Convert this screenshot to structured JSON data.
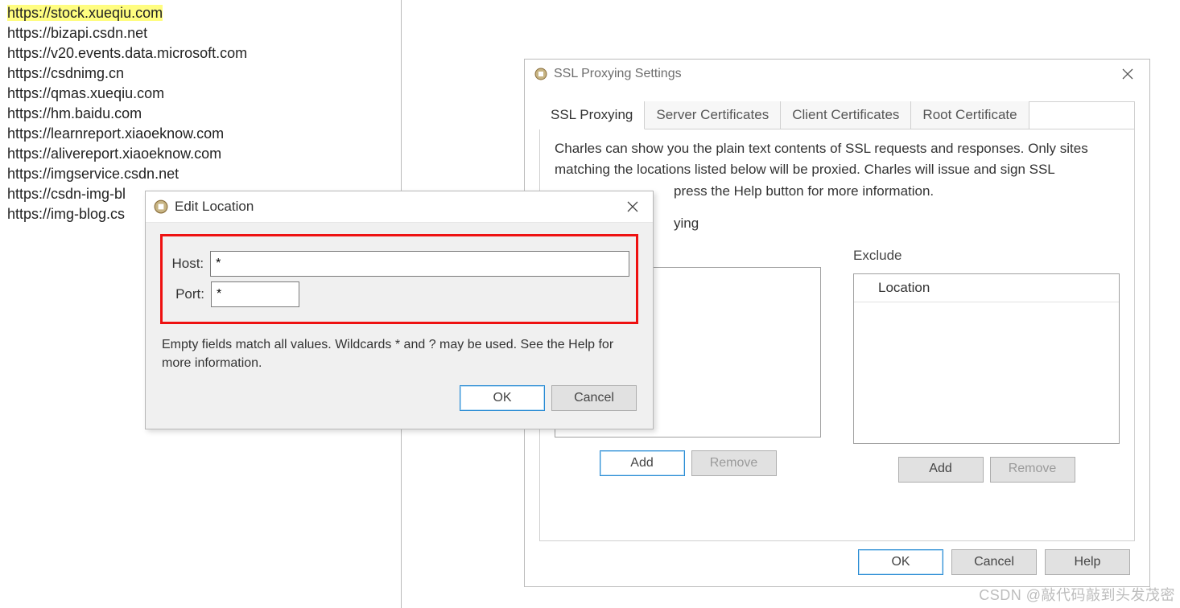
{
  "hosts": [
    {
      "text": "https://stock.xueqiu.com",
      "highlight": true
    },
    {
      "text": "https://bizapi.csdn.net"
    },
    {
      "text": "https://v20.events.data.microsoft.com"
    },
    {
      "text": "https://csdnimg.cn"
    },
    {
      "text": "https://qmas.xueqiu.com"
    },
    {
      "text": "https://hm.baidu.com"
    },
    {
      "text": "https://learnreport.xiaoeknow.com"
    },
    {
      "text": "https://alivereport.xiaoeknow.com"
    },
    {
      "text": "https://imgservice.csdn.net"
    },
    {
      "text": "https://csdn-img-bl"
    },
    {
      "text": "https://img-blog.cs"
    }
  ],
  "sslwin": {
    "title": "SSL Proxying Settings",
    "tabs": [
      "SSL Proxying",
      "Server Certificates",
      "Client Certificates",
      "Root Certificate"
    ],
    "desc": "Charles can show you the plain text contents of SSL requests and responses. Only sites matching the locations listed below will be proxied. Charles will issue and sign SSL",
    "desc_cut": "press the Help button for more information.",
    "checkbox_cut": "ying",
    "exclude_heading": "Exclude",
    "location_header": "Location",
    "add": "Add",
    "remove": "Remove",
    "ok": "OK",
    "cancel": "Cancel",
    "help": "Help"
  },
  "editdlg": {
    "title": "Edit Location",
    "host_label": "Host:",
    "port_label": "Port:",
    "host_value": "*",
    "port_value": "*",
    "hint": "Empty fields match all values. Wildcards * and ? may be used. See the Help for more information.",
    "ok": "OK",
    "cancel": "Cancel"
  },
  "watermark": "CSDN @敲代码敲到头发茂密"
}
